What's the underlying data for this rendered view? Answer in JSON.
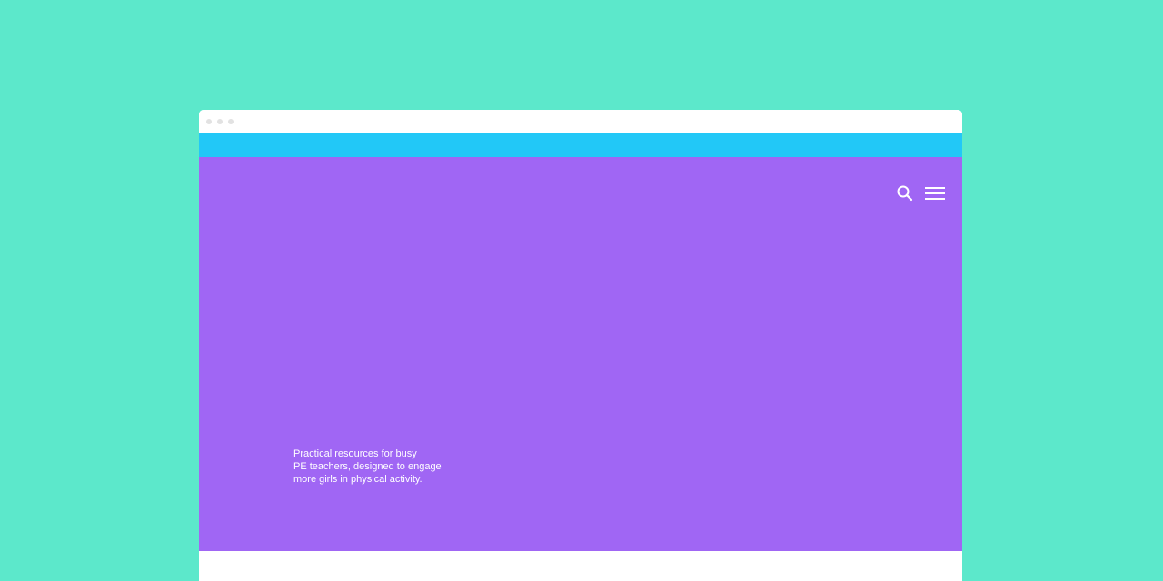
{
  "colors": {
    "background": "#5ce8cb",
    "banner": "#22c8f7",
    "hero": "#a066f4",
    "window": "#ffffff",
    "icons": "#ffffff"
  },
  "header": {
    "search_icon": "search-icon",
    "menu_icon": "hamburger-menu-icon"
  },
  "hero": {
    "tagline_lines": [
      "Practical resources for busy",
      "PE teachers, designed to engage",
      "more girls in physical activity."
    ]
  }
}
